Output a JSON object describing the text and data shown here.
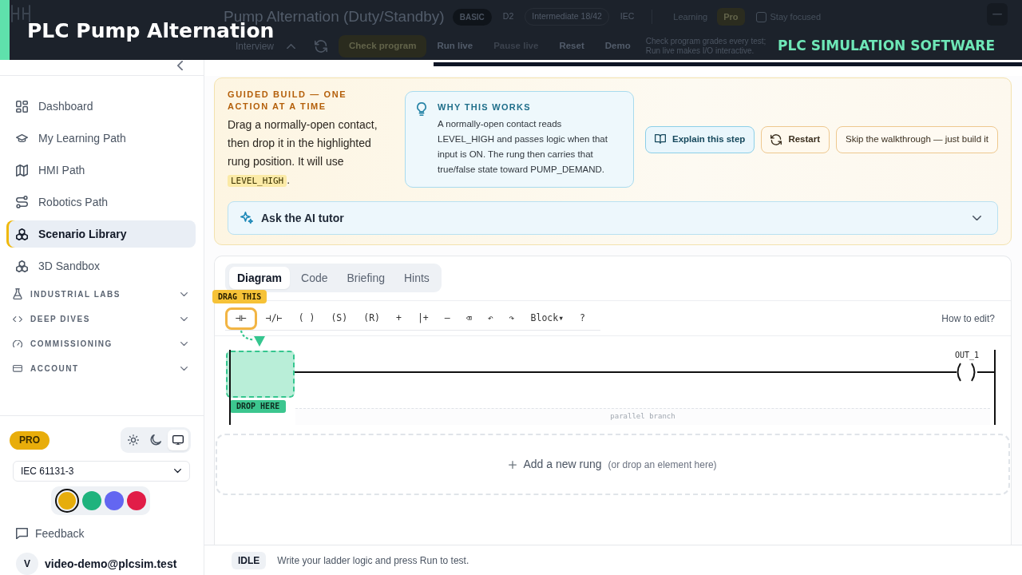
{
  "overlay": {
    "title": "PLC Pump Alternation",
    "tagline": "PLC SIMULATION SOFTWARE"
  },
  "header": {
    "title": "Pump Alternation (Duty/Standby)",
    "badges": [
      {
        "label": "BASIC",
        "kind": "pill"
      },
      {
        "label": "D2",
        "kind": "text"
      },
      {
        "label": "Intermediate 18/42",
        "kind": "outline"
      },
      {
        "label": "IEC",
        "kind": "text"
      }
    ],
    "modes": [
      {
        "label": "Learning",
        "selected": false
      },
      {
        "label": "Pro",
        "selected": true
      }
    ],
    "stay_focused": {
      "label": "Stay focused",
      "checked": false
    },
    "view": "Interview",
    "actions": [
      {
        "label": "Check program",
        "kind": "primary",
        "disabled": false
      },
      {
        "label": "Run live",
        "kind": "plain",
        "disabled": false
      },
      {
        "label": "Pause live",
        "kind": "plain",
        "disabled": true
      },
      {
        "label": "Reset",
        "kind": "plain",
        "disabled": false
      },
      {
        "label": "Demo",
        "kind": "plain",
        "disabled": false
      }
    ],
    "help": "Check program grades every test; Run live makes I/O interactive."
  },
  "sidebar": {
    "items": [
      {
        "label": "Dashboard",
        "selected": false
      },
      {
        "label": "My Learning Path",
        "selected": false
      },
      {
        "label": "HMI Path",
        "selected": false
      },
      {
        "label": "Robotics Path",
        "selected": false
      },
      {
        "label": "Scenario Library",
        "selected": true
      },
      {
        "label": "3D Sandbox",
        "selected": false
      }
    ],
    "sections": [
      {
        "label": "INDUSTRIAL LABS",
        "expanded": false
      },
      {
        "label": "DEEP DIVES",
        "expanded": false
      },
      {
        "label": "COMMISSIONING",
        "expanded": false
      },
      {
        "label": "ACCOUNT",
        "expanded": false
      }
    ],
    "plan": "PRO",
    "theme_modes": [
      {
        "selected": false
      },
      {
        "selected": false
      },
      {
        "selected": true
      }
    ],
    "standard": "IEC 61131-3",
    "accent_colors": [
      {
        "color": "#e6ad0c",
        "selected": true
      },
      {
        "color": "#1fb37d",
        "selected": false
      },
      {
        "color": "#6366f1",
        "selected": false
      },
      {
        "color": "#e11d48",
        "selected": false
      }
    ],
    "feedback": "Feedback",
    "user": {
      "initial": "V",
      "email": "video-demo@plcsim.test"
    }
  },
  "guide": {
    "heading": "GUIDED BUILD — ONE ACTION AT A TIME",
    "instruction": {
      "text": "Drag a normally-open contact, then drop it in the highlighted rung position. It will use",
      "code": "LEVEL_HIGH",
      "end": "."
    },
    "why": {
      "heading": "WHY THIS WORKS",
      "text": "A normally-open contact reads LEVEL_HIGH and passes logic when that input is ON. The rung then carries that true/false state toward PUMP_DEMAND."
    },
    "buttons": [
      {
        "label": "Explain this step",
        "kind": "info"
      },
      {
        "label": "Restart",
        "kind": "warn"
      },
      {
        "label": "Skip the walkthrough — just build it",
        "kind": "plain"
      }
    ],
    "tutor": {
      "label": "Ask the AI tutor",
      "expanded": false
    }
  },
  "editor": {
    "tabs": [
      {
        "label": "Diagram",
        "selected": true
      },
      {
        "label": "Code",
        "selected": false
      },
      {
        "label": "Briefing",
        "selected": false
      },
      {
        "label": "Hints",
        "selected": false
      }
    ],
    "drag_hint": "DRAG THIS",
    "tools": [
      {
        "label": "⊣⊢",
        "highlighted": true
      },
      {
        "label": "⊣/⊢",
        "highlighted": false
      },
      {
        "label": "( )",
        "highlighted": false
      },
      {
        "label": "(S)",
        "highlighted": false
      },
      {
        "label": "(R)",
        "highlighted": false
      },
      {
        "label": "+",
        "highlighted": false
      },
      {
        "label": "|+",
        "highlighted": false
      },
      {
        "label": "–",
        "highlighted": false
      },
      {
        "label": "⌫",
        "highlighted": false
      },
      {
        "label": "↶",
        "highlighted": false
      },
      {
        "label": "↷",
        "highlighted": false
      },
      {
        "label": "Block▾",
        "highlighted": false
      },
      {
        "label": "?",
        "highlighted": false
      }
    ],
    "help_link": "How to edit?",
    "rung": {
      "coil_label": "OUT_1",
      "drop_label": "DROP HERE",
      "branch_label": "parallel branch"
    },
    "add_rung": {
      "label": "Add a new rung",
      "hint": "(or drop an element here)"
    }
  },
  "status_bar": {
    "state": "IDLE",
    "message": "Write your ladder logic and press Run to test."
  }
}
